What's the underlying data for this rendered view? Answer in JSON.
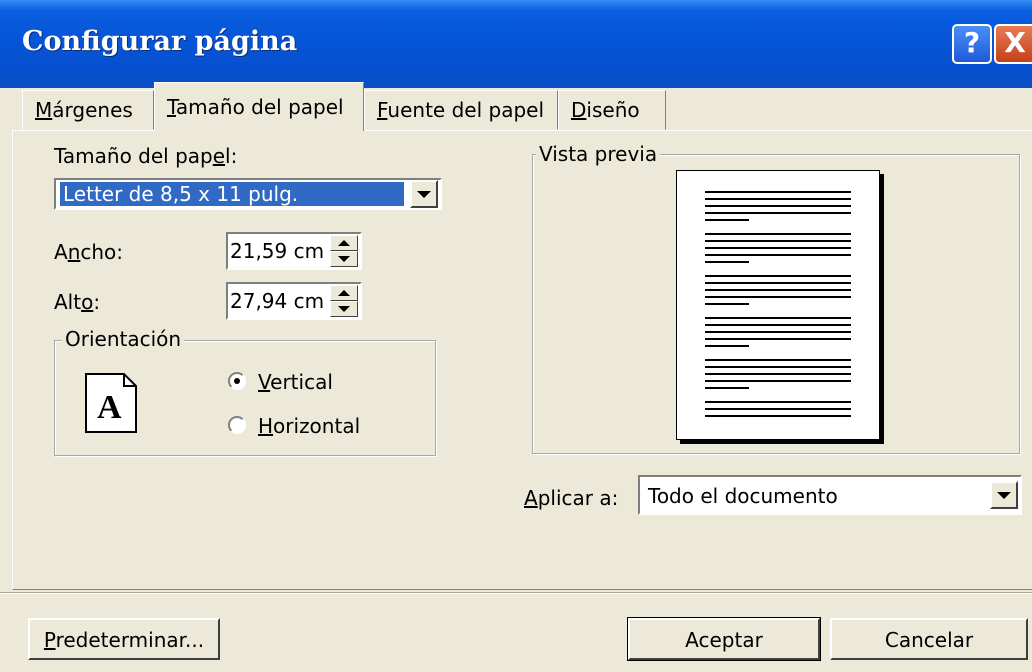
{
  "window": {
    "title": "Configurar página"
  },
  "titlebar": {
    "help_symbol": "?",
    "close_symbol": "X"
  },
  "tabs": [
    {
      "label": "Márgenes",
      "mnemonic_index": 0,
      "active": false
    },
    {
      "label": "Tamaño del papel",
      "mnemonic_index": 0,
      "active": true
    },
    {
      "label": "Fuente del papel",
      "mnemonic_index": 0,
      "active": false
    },
    {
      "label": "Diseño",
      "mnemonic_index": 0,
      "active": false
    }
  ],
  "paper_size": {
    "label_pre": "Tamaño del pap",
    "label_ul": "e",
    "label_post": "l:",
    "value": "Letter de 8,5 x 11 pulg."
  },
  "width": {
    "label_pre": "A",
    "label_ul": "n",
    "label_post": "cho:",
    "value": "21,59 cm"
  },
  "height": {
    "label_pre": "Alt",
    "label_ul": "o",
    "label_post": ":",
    "value": "27,94 cm"
  },
  "orientation": {
    "group_label": "Orientación",
    "icon_letter": "A",
    "options": [
      {
        "ul": "V",
        "rest": "ertical",
        "selected": true
      },
      {
        "ul": "H",
        "rest": "orizontal",
        "selected": false
      }
    ]
  },
  "preview": {
    "group_label": "Vista previa"
  },
  "apply_to": {
    "label_ul": "A",
    "label_rest": "plicar a:",
    "value": "Todo el documento"
  },
  "buttons": {
    "default_ul": "P",
    "default_rest": "redeterminar...",
    "ok": "Aceptar",
    "cancel": "Cancelar"
  },
  "colors": {
    "titlebar": "#0756d8",
    "face": "#ece9d8",
    "selection": "#316ac5"
  },
  "icons": {
    "help": "help-icon",
    "close": "close-icon",
    "dropdown": "chevron-down-icon",
    "portrait": "portrait-page-icon"
  }
}
